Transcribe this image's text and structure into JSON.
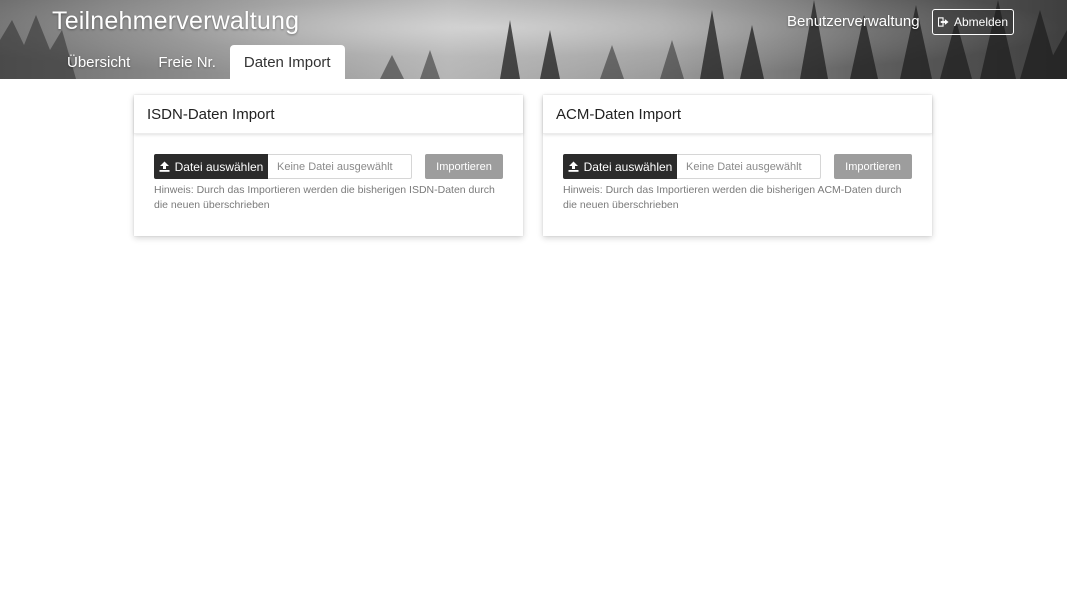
{
  "header": {
    "app_title": "Teilnehmerverwaltung",
    "user_admin_label": "Benutzerverwaltung",
    "logout_label": "Abmelden",
    "logout_icon": "sign-out-icon"
  },
  "tabs": [
    {
      "label": "Übersicht",
      "active": false
    },
    {
      "label": "Freie Nr.",
      "active": false
    },
    {
      "label": "Daten Import",
      "active": true
    }
  ],
  "cards": [
    {
      "title": "ISDN-Daten Import",
      "choose_file_label": "Datei auswählen",
      "choose_file_icon": "upload-icon",
      "file_placeholder": "Keine Datei ausgewählt",
      "import_label": "Importieren",
      "hint": "Hinweis: Durch das Importieren werden die bisherigen ISDN-Daten durch die neuen überschrieben"
    },
    {
      "title": "ACM-Daten Import",
      "choose_file_label": "Datei auswählen",
      "choose_file_icon": "upload-icon",
      "file_placeholder": "Keine Datei ausgewählt",
      "import_label": "Importieren",
      "hint": "Hinweis: Durch das Importieren werden die bisherigen ACM-Daten durch die neuen überschrieben"
    }
  ],
  "colors": {
    "dark_button": "#2b2b2b",
    "disabled_button": "#9d9d9d",
    "hint_text": "#7a7a7a"
  }
}
